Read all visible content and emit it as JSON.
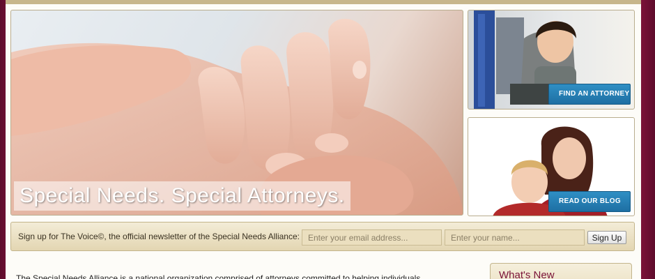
{
  "hero": {
    "caption": "Special Needs. Special Attorneys."
  },
  "promos": [
    {
      "button_label": "FIND AN ATTORNEY"
    },
    {
      "button_label": "READ OUR BLOG"
    }
  ],
  "newsletter": {
    "text": "Sign up for The Voice©, the official newsletter of the Special Needs Alliance:",
    "email_placeholder": "Enter your email address...",
    "name_placeholder": "Enter your name...",
    "button_label": "Sign Up"
  },
  "intro": {
    "text": "The Special Needs Alliance is a national organization comprised of attorneys committed to helping individuals"
  },
  "sidebar": {
    "whats_new_title": "What's New"
  },
  "colors": {
    "background": "#7a1238",
    "accent_button": "#1e6fa3",
    "newsletter_bar": "#e3d6b2"
  }
}
